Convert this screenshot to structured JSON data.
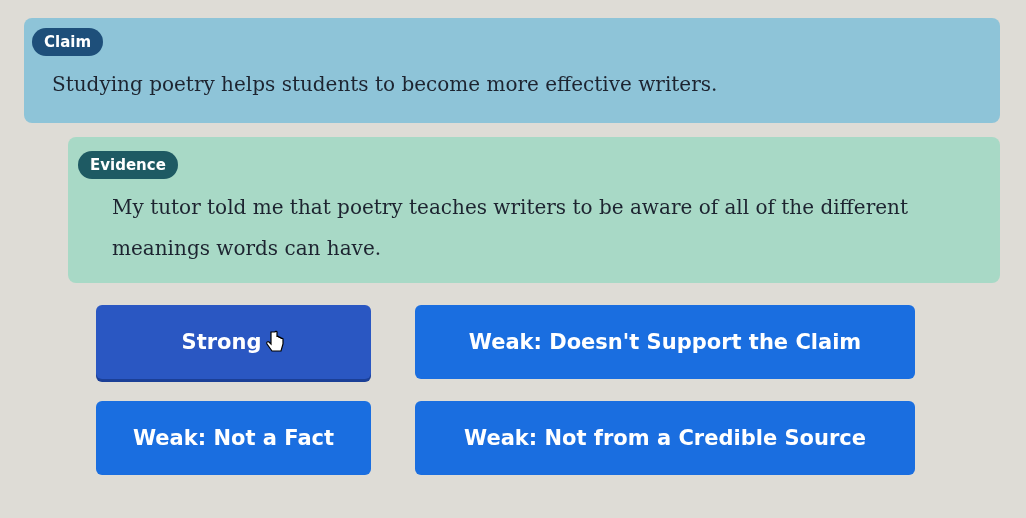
{
  "claim": {
    "badge": "Claim",
    "text": "Studying poetry helps students to become more effective writers."
  },
  "evidence": {
    "badge": "Evidence",
    "text": "My tutor told me that poetry teaches writers to be aware of all of the different meanings words can have."
  },
  "options": [
    {
      "label": "Strong",
      "hovered": true
    },
    {
      "label": "Weak: Doesn't Support the Claim",
      "hovered": false
    },
    {
      "label": "Weak: Not a Fact",
      "hovered": false
    },
    {
      "label": "Weak: Not from a Credible Source",
      "hovered": false
    }
  ]
}
